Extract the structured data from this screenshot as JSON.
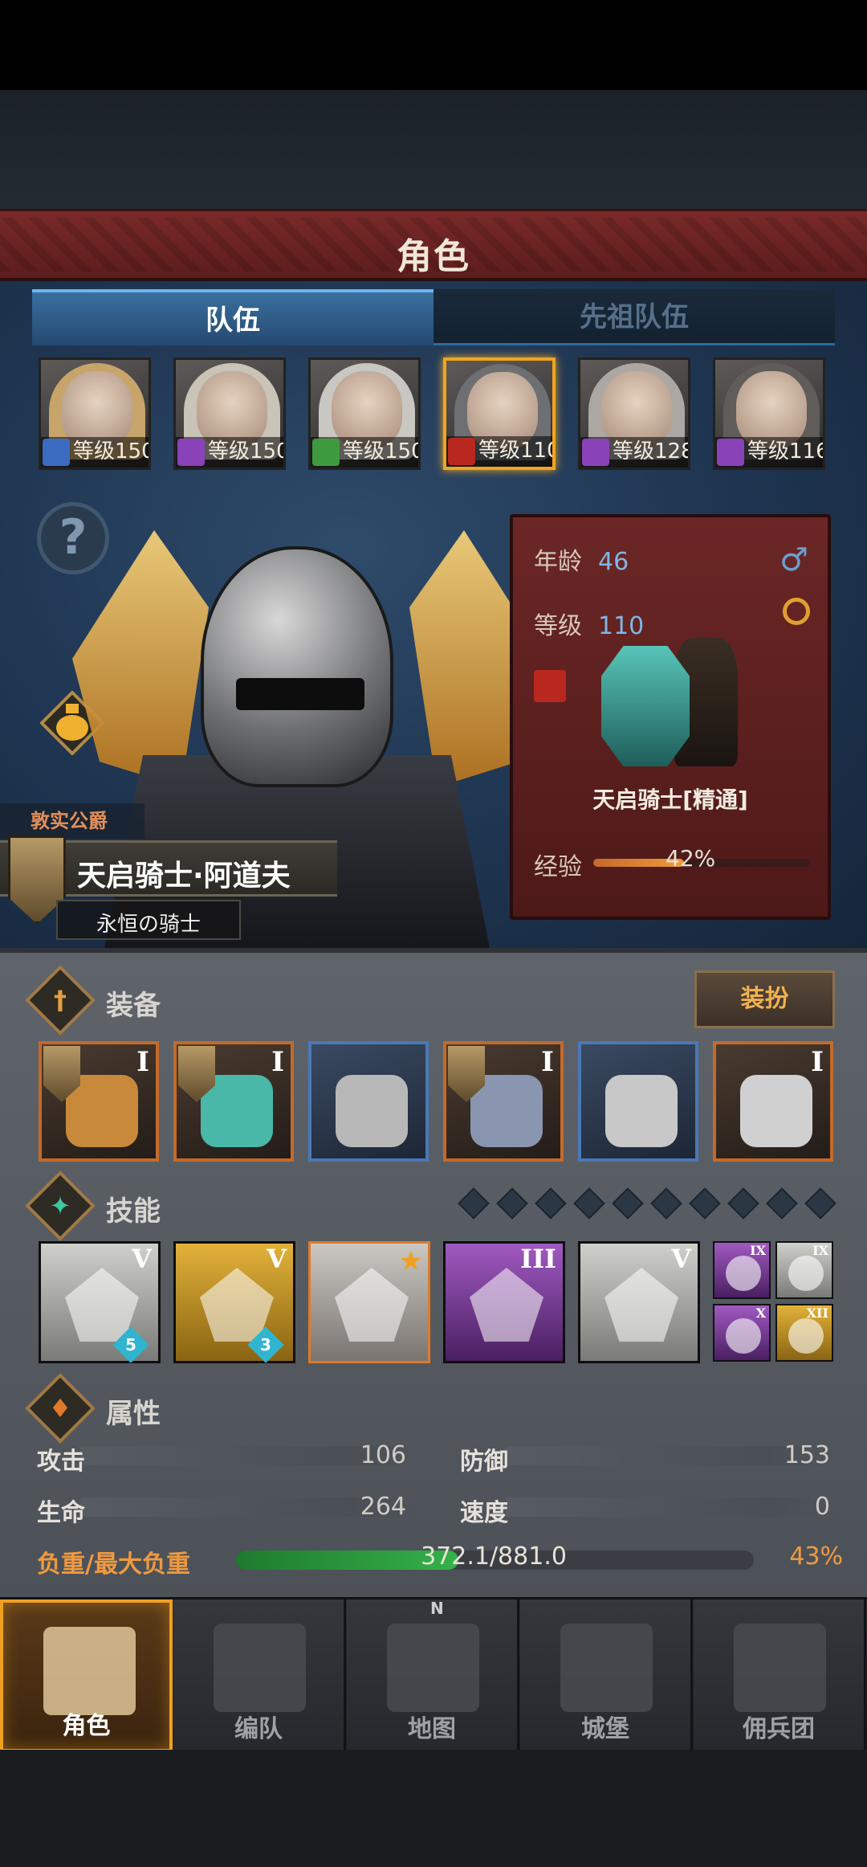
{
  "header": {
    "title": "角色"
  },
  "tabs": [
    {
      "label": "队伍",
      "active": true
    },
    {
      "label": "先祖队伍",
      "active": false
    }
  ],
  "roster": [
    {
      "level_text": "等级150",
      "class_icon": "sword-icon",
      "class_color": "#3b6bc0",
      "hair": "#c7a46a"
    },
    {
      "level_text": "等级150",
      "class_icon": "staff-icon",
      "class_color": "#8a42b8",
      "hair": "#c9c3b8"
    },
    {
      "level_text": "等级150",
      "class_icon": "bow-icon",
      "class_color": "#3e9a3e",
      "hair": "#c9c7c2"
    },
    {
      "level_text": "等级110",
      "class_icon": "horse-icon",
      "class_color": "#b8281f",
      "hair": "#6e6f73",
      "selected": true
    },
    {
      "level_text": "等级128",
      "class_icon": "staff-icon",
      "class_color": "#8a42b8",
      "hair": "#aca7a2"
    },
    {
      "level_text": "等级116",
      "class_icon": "staff-icon",
      "class_color": "#8a42b8",
      "hair": "#5f5c5a"
    }
  ],
  "character": {
    "title_label": "敦实公爵",
    "name": "天启骑士·阿道夫",
    "subtitle": "永恒の骑士"
  },
  "info_banner": {
    "age_label": "年龄",
    "age_value": "46",
    "gender_symbol": "♂",
    "level_label": "等级",
    "level_value": "110",
    "class_name": "天启骑士[精通]",
    "exp_label": "经验",
    "exp_text": "42%",
    "exp_fraction": 0.42
  },
  "equipment": {
    "title": "装备",
    "dress_button": "装扮",
    "items": [
      {
        "name": "weapon",
        "rank": "I",
        "border": "orange",
        "has_badge": true,
        "icon": "scepter-icon"
      },
      {
        "name": "shield",
        "rank": "I",
        "border": "orange",
        "has_badge": true,
        "icon": "shield-icon"
      },
      {
        "name": "helmet",
        "rank": "",
        "border": "blue",
        "has_badge": false,
        "icon": "helmet-icon"
      },
      {
        "name": "armor",
        "rank": "I",
        "border": "orange",
        "has_badge": true,
        "icon": "armor-icon"
      },
      {
        "name": "boots",
        "rank": "",
        "border": "blue",
        "has_badge": false,
        "icon": "boots-icon"
      },
      {
        "name": "accessory",
        "rank": "I",
        "border": "orange",
        "has_badge": false,
        "icon": "horn-icon"
      }
    ]
  },
  "skills": {
    "title": "技能",
    "slot_dots": 10,
    "items": [
      {
        "rank": "V",
        "style": "grey",
        "gem": "5",
        "icon": "holy-spear-icon"
      },
      {
        "rank": "V",
        "style": "gold",
        "gem": "3",
        "icon": "healing-shield-icon"
      },
      {
        "rank": "",
        "style": "orange",
        "gem": "",
        "icon": "crystal-arm-icon",
        "star": true
      },
      {
        "rank": "III",
        "style": "purple",
        "gem": "",
        "icon": "crystal-arm-icon"
      },
      {
        "rank": "V",
        "style": "grey",
        "gem": "",
        "icon": "crystal-arm-icon"
      }
    ],
    "mini": [
      {
        "rank": "IX",
        "style": "purple",
        "icon": "radiance-icon"
      },
      {
        "rank": "IX",
        "style": "grey",
        "icon": "burst-icon"
      },
      {
        "rank": "X",
        "style": "purple",
        "icon": "wand-icon"
      },
      {
        "rank": "XII",
        "style": "gold",
        "icon": "shield-icon"
      }
    ]
  },
  "attributes": {
    "title": "属性",
    "attack_label": "攻击",
    "attack_value": "106",
    "defense_label": "防御",
    "defense_value": "153",
    "life_label": "生命",
    "life_value": "264",
    "speed_label": "速度",
    "speed_value": "0",
    "load_label": "负重/最大负重",
    "load_text": "372.1/881.0",
    "load_pct": "43%",
    "load_fraction": 0.43
  },
  "nav": [
    {
      "label": "角色",
      "icon": "knight-icon",
      "active": true
    },
    {
      "label": "编队",
      "icon": "helmet-group-icon",
      "active": false
    },
    {
      "label": "地图",
      "icon": "compass-map-icon",
      "active": false
    },
    {
      "label": "城堡",
      "icon": "castle-icon",
      "active": false
    },
    {
      "label": "佣兵团",
      "icon": "mercenary-flag-icon",
      "active": false
    }
  ],
  "compass_letter": "N",
  "colors": {
    "accent_orange": "#f0a020",
    "title_red": "#7a2a28",
    "tab_blue": "#3a6f9f"
  }
}
